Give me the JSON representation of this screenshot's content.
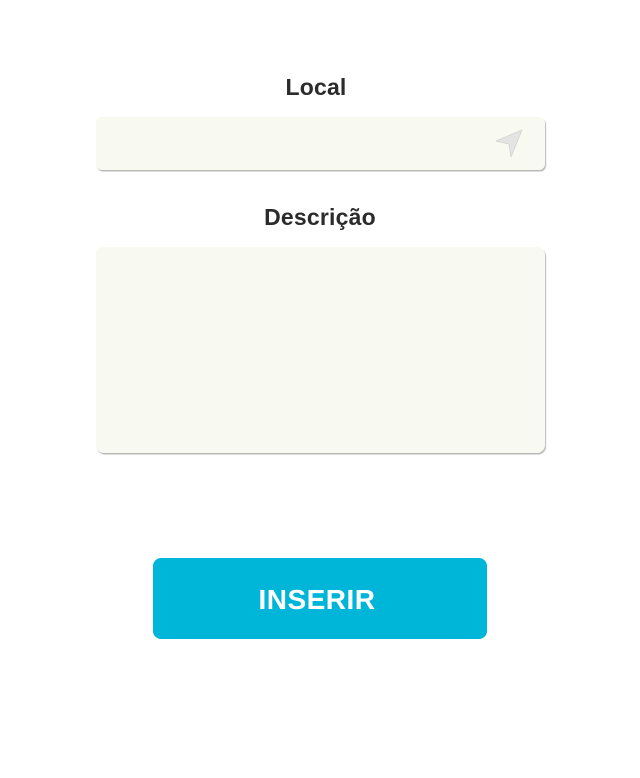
{
  "form": {
    "location_label": "Local",
    "location_value": "",
    "location_icon": "location-arrow-icon",
    "description_label": "Descrição",
    "description_value": "",
    "submit_label": "INSERIR"
  },
  "colors": {
    "field_background": "#f8f9f0",
    "button_background": "#00b6d8",
    "label_text": "#2b2b2b",
    "button_text": "#ffffff"
  }
}
